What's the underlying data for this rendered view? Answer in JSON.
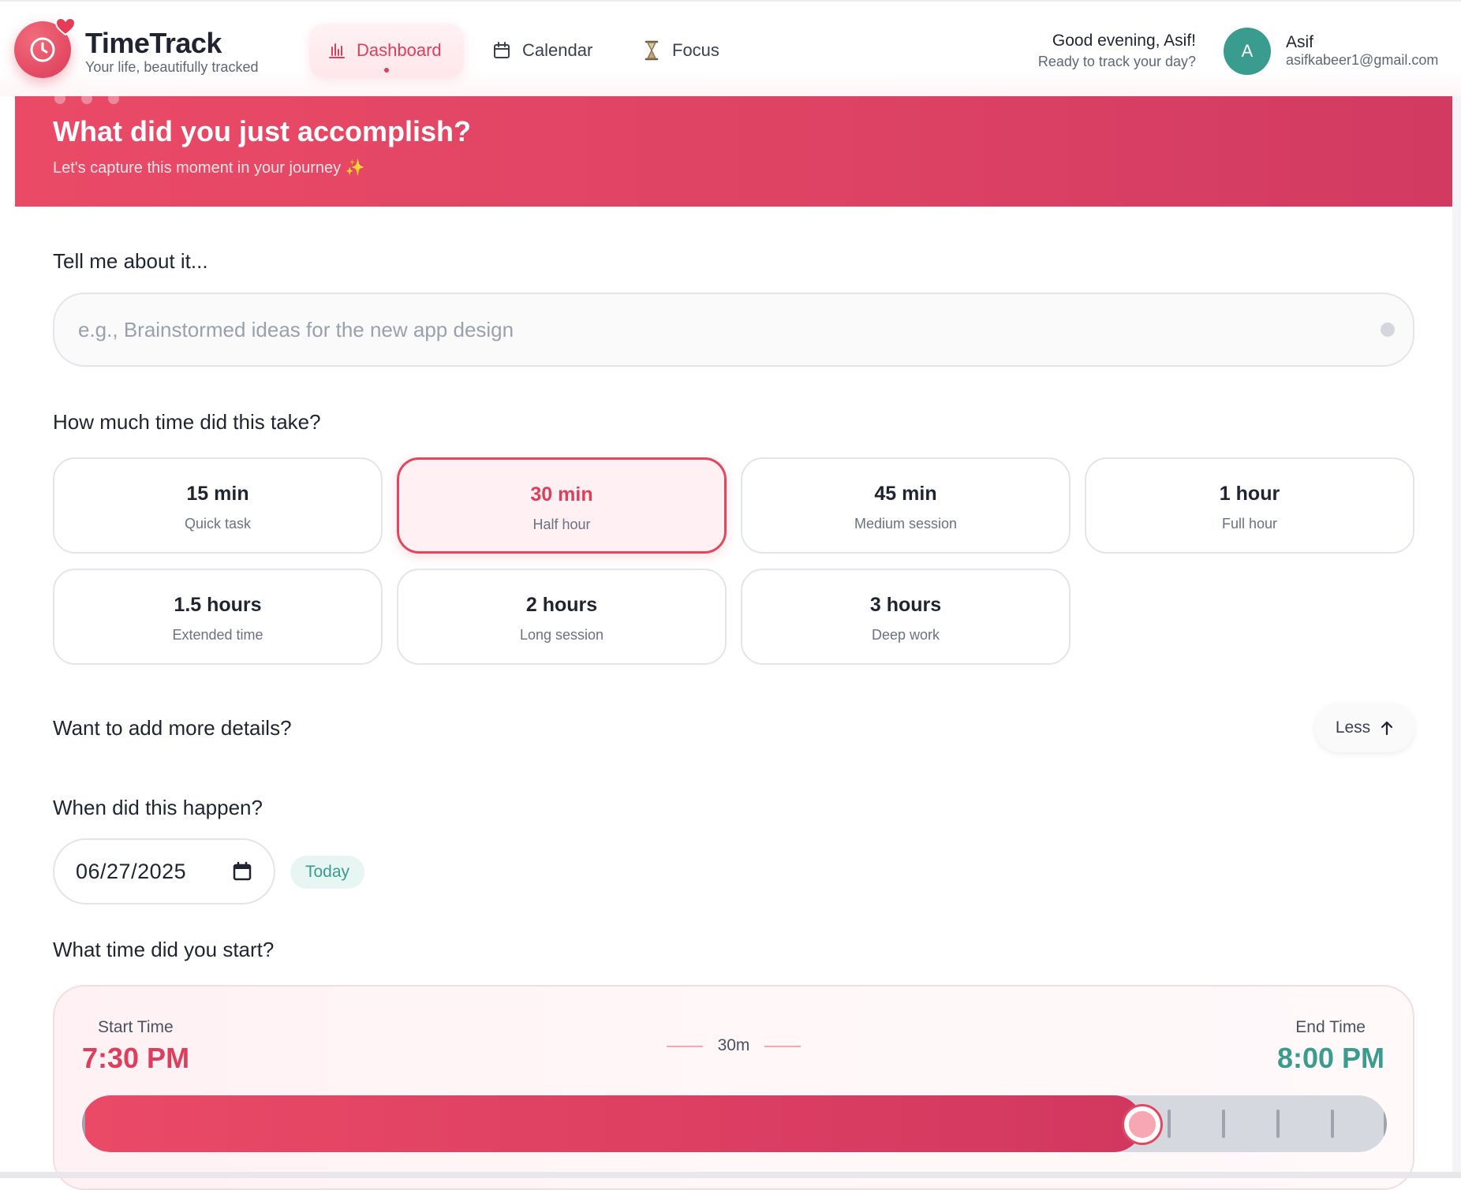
{
  "header": {
    "brand_title": "TimeTrack",
    "brand_subtitle": "Your life, beautifully tracked",
    "nav": [
      {
        "label": "Dashboard",
        "icon": "bar-chart-icon",
        "active": true
      },
      {
        "label": "Calendar",
        "icon": "calendar-icon",
        "active": false
      },
      {
        "label": "Focus",
        "icon": "hourglass-icon",
        "active": false
      }
    ],
    "greeting": "Good evening, Asif!",
    "greeting_sub": "Ready to track your day?",
    "avatar_initial": "A",
    "user_name": "Asif",
    "user_email": "asifkabeer1@gmail.com"
  },
  "banner": {
    "title": "What did you just accomplish?",
    "subtitle": "Let's capture this moment in your journey ✨"
  },
  "form": {
    "describe_label": "Tell me about it...",
    "describe_placeholder": "e.g., Brainstormed ideas for the new app design",
    "describe_value": "",
    "duration_label": "How much time did this take?",
    "durations": [
      {
        "title": "15 min",
        "sub": "Quick task",
        "selected": false
      },
      {
        "title": "30 min",
        "sub": "Half hour",
        "selected": true
      },
      {
        "title": "45 min",
        "sub": "Medium session",
        "selected": false
      },
      {
        "title": "1 hour",
        "sub": "Full hour",
        "selected": false
      },
      {
        "title": "1.5 hours",
        "sub": "Extended time",
        "selected": false
      },
      {
        "title": "2 hours",
        "sub": "Long session",
        "selected": false
      },
      {
        "title": "3 hours",
        "sub": "Deep work",
        "selected": false
      }
    ],
    "details_label": "Want to add more details?",
    "less_label": "Less",
    "when_label": "When did this happen?",
    "date_value": "06/27/2025",
    "today_label": "Today",
    "start_question": "What time did you start?",
    "start_time_label": "Start Time",
    "start_time_value": "7:30 PM",
    "duration_display": "30m",
    "end_time_label": "End Time",
    "end_time_value": "8:00 PM",
    "slider_fraction": 0.8125
  },
  "colors": {
    "accent": "#e03d5c",
    "teal": "#3a9c8e"
  }
}
